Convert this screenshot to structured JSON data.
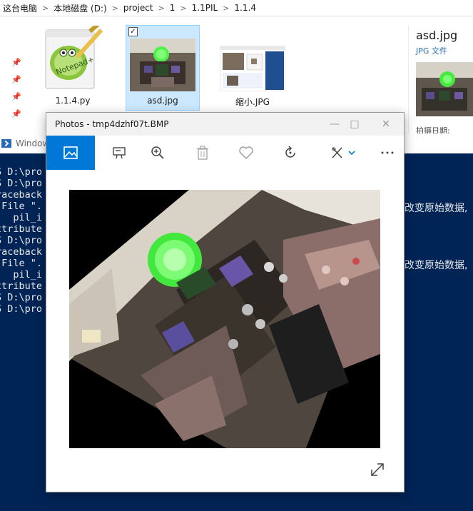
{
  "explorer": {
    "breadcrumbs": [
      "这台电脑",
      "本地磁盘 (D:)",
      "project",
      "1",
      "1.1PIL",
      "1.1.4"
    ],
    "files": [
      {
        "name": "1.1.4.py",
        "icon": "notepad-plus-plus-icon"
      },
      {
        "name": "asd.jpg",
        "icon": "image-thumbnail",
        "selected": true
      },
      {
        "name": "缩小.JPG",
        "icon": "screenshot-thumbnail"
      }
    ],
    "details": {
      "title": "asd.jpg",
      "type": "JPG 文件",
      "date_label": "拍摄日期:"
    }
  },
  "shell": {
    "title": "Windows PowerShell",
    "lines": [
      "S D:\\pro",
      "S D:\\pro",
      "raceback",
      " File \".",
      "   pil_i",
      "ttribute",
      "S D:\\pro",
      "raceback",
      " File \".",
      "   pil_i",
      "ttribute",
      "S D:\\pro",
      "S D:\\pro"
    ],
    "side_text": "改变原始数据,"
  },
  "photos": {
    "title": "Photos - tmp4dzhf07t.BMP",
    "toolbar": [
      "image-icon",
      "present-icon",
      "zoom-in-icon",
      "delete-icon",
      "heart-icon",
      "rotate-icon",
      "edit-draw-icon",
      "more-icon"
    ],
    "colors": {
      "accent": "#0078d7",
      "shell_bg": "#012456",
      "selection": "#cce8ff"
    }
  }
}
